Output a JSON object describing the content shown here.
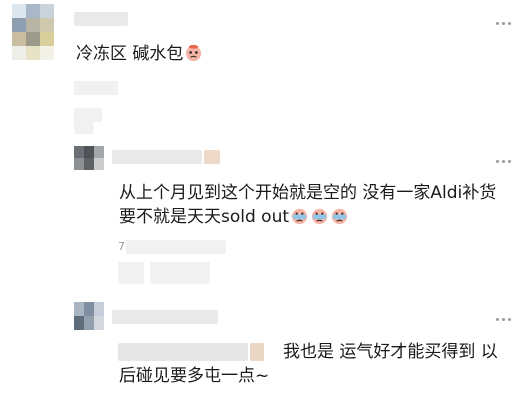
{
  "comments": [
    {
      "text": "冷冻区 碱水包",
      "emoji": "crying-face-emoji"
    },
    {
      "line1": "从上个月见到这个开始就是空的 没有一家Aldi补货",
      "line2": "要不就是天天sold out",
      "emoji_count": 3,
      "emoji": "sweating-face-emoji",
      "meta_prefix": "7"
    },
    {
      "line1": "我也是 运气好才能买得到 以",
      "line2": "后碰见要多屯一点~"
    }
  ],
  "colors": {
    "text": "#1a1a1a",
    "muted": "#9a9a9a",
    "blur": "#e9e9e9"
  }
}
